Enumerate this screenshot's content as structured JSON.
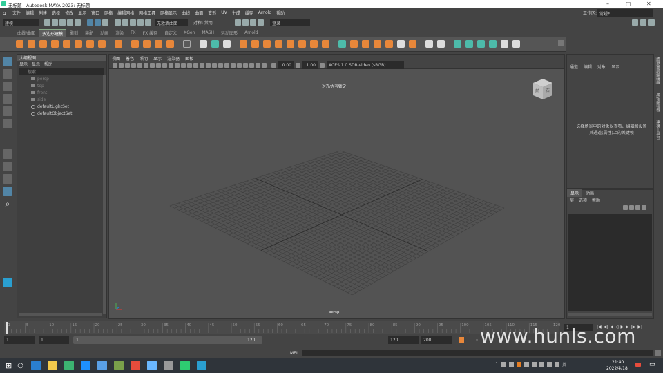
{
  "titlebar": {
    "title": "无标题 - Autodesk MAYA 2023: 无标题",
    "min": "–",
    "max": "▢",
    "close": "✕"
  },
  "menubar": {
    "items": [
      "文件",
      "编辑",
      "创建",
      "选择",
      "修改",
      "显示",
      "窗口",
      "网格",
      "编辑网格",
      "网格工具",
      "网格显示",
      "曲线",
      "曲面",
      "变形",
      "UV",
      "生成",
      "缓存",
      "Arnold",
      "帮助"
    ],
    "workspace_label": "工作区:",
    "workspace_value": "常规*"
  },
  "statusline": {
    "mode": "建模",
    "no_live_surface": "无激活曲面",
    "symmetry": "对称: 禁用",
    "login": "登录"
  },
  "shelf": {
    "tabs": [
      "曲线/曲面",
      "多边形建模",
      "雕刻",
      "装配",
      "动画",
      "渲染",
      "FX",
      "FX 缓存",
      "自定义",
      "XGen",
      "MASH",
      "运动图形",
      "Arnold"
    ],
    "active_tab": "多边形建模"
  },
  "outliner": {
    "title": "大纲视图",
    "menu": [
      "显示",
      "显示",
      "帮助"
    ],
    "search_placeholder": "搜索...",
    "items": [
      {
        "label": "persp",
        "type": "camera",
        "dim": true
      },
      {
        "label": "top",
        "type": "camera",
        "dim": true
      },
      {
        "label": "front",
        "type": "camera",
        "dim": true
      },
      {
        "label": "side",
        "type": "camera",
        "dim": true
      },
      {
        "label": "defaultLightSet",
        "type": "set",
        "dim": false
      },
      {
        "label": "defaultObjectSet",
        "type": "set",
        "dim": false
      }
    ]
  },
  "viewport": {
    "menu": [
      "视图",
      "着色",
      "照明",
      "显示",
      "渲染器",
      "面板"
    ],
    "exposure": "0.00",
    "gamma": "1.00",
    "colorspace": "ACES 1.0 SDR-video (sRGB)",
    "hud_title": "对齐/大写锁定",
    "camera_label": "persp",
    "viewcube_front": "前",
    "viewcube_right": "右"
  },
  "channelbox": {
    "menu": [
      "通道",
      "编辑",
      "对象",
      "显示"
    ],
    "message": "选择场景中的对象以查看、编辑和设置其通道(属性)上的关键帧"
  },
  "layers": {
    "tabs": [
      "显示",
      "动画"
    ],
    "menu": [
      "层",
      "选项",
      "帮助"
    ]
  },
  "sidetabs": [
    "通道盒/层编辑器",
    "属性编辑器",
    "建模工具包"
  ],
  "timeline": {
    "ticks": [
      "1",
      "5",
      "10",
      "15",
      "20",
      "25",
      "30",
      "35",
      "40",
      "45",
      "50",
      "55",
      "60",
      "65",
      "70",
      "75",
      "80",
      "85",
      "90",
      "95",
      "100",
      "105",
      "110",
      "115",
      "120"
    ],
    "current_frame": "1"
  },
  "range": {
    "start": "1",
    "playback_start": "1",
    "slider_start": "1",
    "slider_end": "120",
    "playback_end": "120",
    "end": "200"
  },
  "cmdline": {
    "label": "MEL"
  },
  "taskbar": {
    "time": "21:40",
    "date": "2022/4/18"
  },
  "watermark": "www.hunls.com",
  "colors": {
    "accent": "#5285a6",
    "shelf_orange": "#e8873a",
    "shelf_teal": "#4dbbaa"
  }
}
